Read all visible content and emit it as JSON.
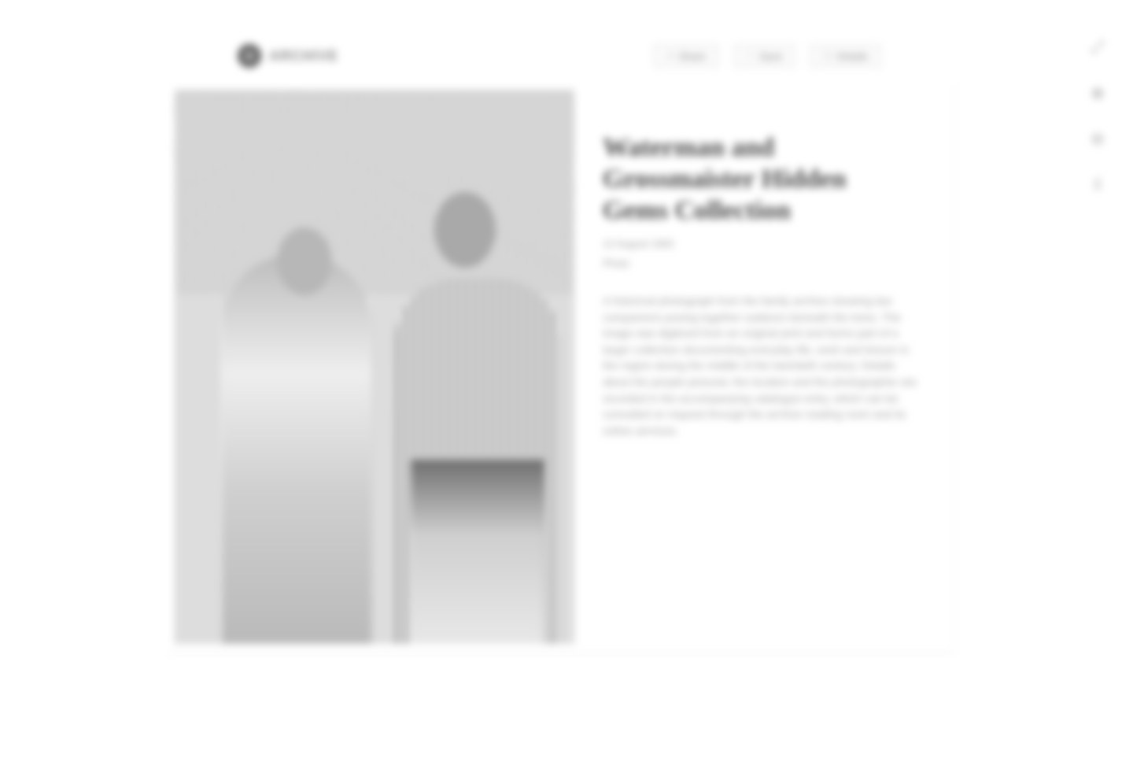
{
  "header": {
    "logo_text": "ARCHIVE",
    "nav": [
      {
        "label": "Share",
        "icon": "share-icon",
        "glyph": "↗"
      },
      {
        "label": "Save",
        "icon": "bookmark-icon",
        "glyph": "♡"
      },
      {
        "label": "Details",
        "icon": "info-icon",
        "glyph": "ⓘ"
      }
    ]
  },
  "rail": [
    {
      "icon": "expand-icon",
      "glyph": "⤢"
    },
    {
      "icon": "zoom-in-icon",
      "glyph": "⊕"
    },
    {
      "icon": "zoom-out-icon",
      "glyph": "⊖"
    },
    {
      "icon": "download-icon",
      "glyph": "⇩"
    }
  ],
  "photo": {
    "alt": "Black and white photograph of two people standing outdoors"
  },
  "info": {
    "title": "Waterman and Grossmaister Hidden Gems Collection",
    "date": "12 August 1963",
    "tag": "Photo",
    "description": "A historical photograph from the family archive showing two companions posing together outdoors beneath the trees. The image was digitized from an original print and forms part of a larger collection documenting everyday life, work and leisure in the region during the middle of the twentieth century. Details about the people pictured, the location and the photographer are recorded in the accompanying catalogue entry, which can be consulted on request through the archive reading room and its online services."
  }
}
